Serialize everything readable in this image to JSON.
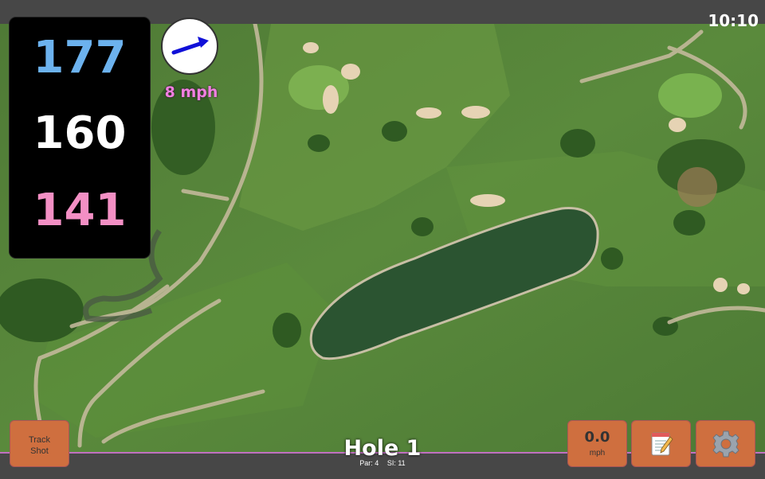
{
  "clock": "10:10",
  "distances": {
    "back": "177",
    "middle": "160",
    "front": "141",
    "colors": {
      "back": "#6cb2ee",
      "middle": "#ffffff",
      "front": "#f38fc4"
    }
  },
  "wind": {
    "speed": "8 mph",
    "arrow_color": "#1010d8"
  },
  "track_shot": {
    "label_line1": "Track",
    "label_line2": "Shot"
  },
  "speed": {
    "value": "0.0",
    "unit": "mph"
  },
  "hole": {
    "title": "Hole 1",
    "par": "Par: 4",
    "si": "SI: 11"
  },
  "icons": {
    "scorecard": "scorecard-notepad-icon",
    "settings": "settings-gear-icon"
  },
  "colors": {
    "button_bg": "#cf6f3f",
    "accent": "#c070c0",
    "bar_bg": "#474747"
  }
}
